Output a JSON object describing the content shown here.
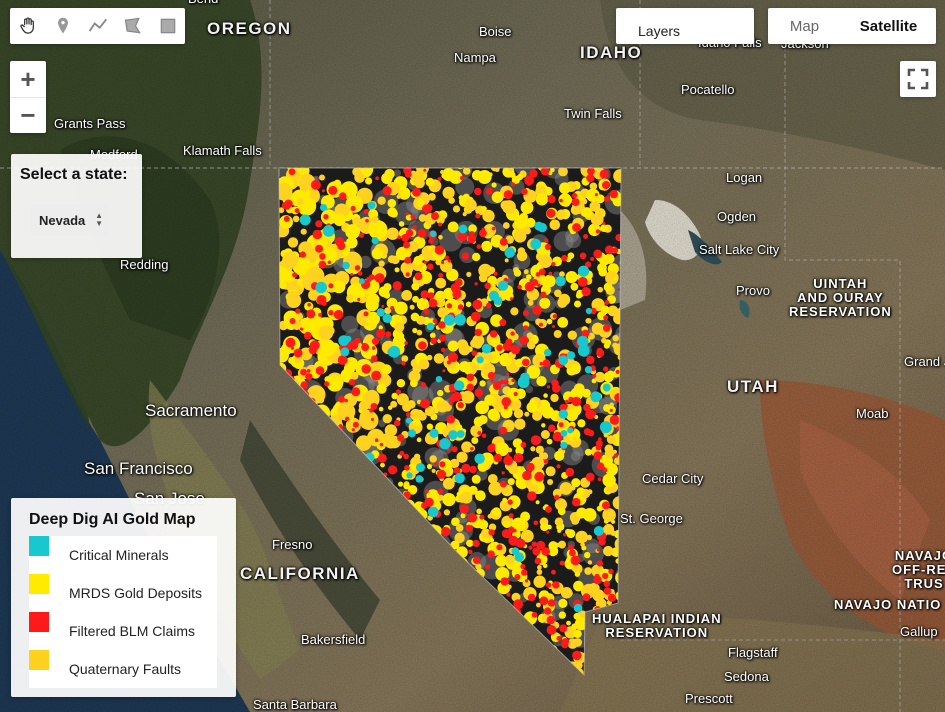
{
  "map": {
    "type": "satellite",
    "colors": {
      "critical": "#17c9cf",
      "mrds": "#ffea00",
      "blm": "#ff1a1a",
      "faults": "#ffd21f"
    },
    "places": [
      {
        "name": "OREGON",
        "kind": "state"
      },
      {
        "name": "IDAHO",
        "kind": "state"
      },
      {
        "name": "UTAH",
        "kind": "state"
      },
      {
        "name": "CALIFORNIA",
        "kind": "state"
      },
      {
        "name": "Bend",
        "kind": "city"
      },
      {
        "name": "Boise",
        "kind": "city"
      },
      {
        "name": "Nampa",
        "kind": "city"
      },
      {
        "name": "Idaho Falls",
        "kind": "city"
      },
      {
        "name": "Jackson",
        "kind": "city"
      },
      {
        "name": "Pocatello",
        "kind": "city"
      },
      {
        "name": "Twin Falls",
        "kind": "city"
      },
      {
        "name": "Grants Pass",
        "kind": "city"
      },
      {
        "name": "Medford",
        "kind": "city"
      },
      {
        "name": "Klamath Falls",
        "kind": "city"
      },
      {
        "name": "Logan",
        "kind": "city"
      },
      {
        "name": "Ogden",
        "kind": "city"
      },
      {
        "name": "Salt Lake City",
        "kind": "city"
      },
      {
        "name": "Provo",
        "kind": "city"
      },
      {
        "name": "UINTAH\nAND OURAY\nRESERVATION",
        "kind": "reserve"
      },
      {
        "name": "Redding",
        "kind": "city"
      },
      {
        "name": "Grand Junction",
        "kind": "city"
      },
      {
        "name": "Moab",
        "kind": "city"
      },
      {
        "name": "Sacramento",
        "kind": "city-big"
      },
      {
        "name": "San Francisco",
        "kind": "city-big"
      },
      {
        "name": "San Jose",
        "kind": "city-big"
      },
      {
        "name": "Cedar City",
        "kind": "city"
      },
      {
        "name": "St. George",
        "kind": "city"
      },
      {
        "name": "Fresno",
        "kind": "city"
      },
      {
        "name": "HUALAPAI INDIAN\nRESERVATION",
        "kind": "reserve"
      },
      {
        "name": "NAVAJO\nOFF-RES\nTRUS",
        "kind": "reserve"
      },
      {
        "name": "NAVAJO NATIO",
        "kind": "reserve"
      },
      {
        "name": "Gallup",
        "kind": "city"
      },
      {
        "name": "Bakersfield",
        "kind": "city"
      },
      {
        "name": "Flagstaff",
        "kind": "city"
      },
      {
        "name": "Sedona",
        "kind": "city"
      },
      {
        "name": "Prescott",
        "kind": "city"
      },
      {
        "name": "Santa Barbara",
        "kind": "city"
      }
    ]
  },
  "toolbar": {
    "tools": [
      {
        "name": "hand-icon"
      },
      {
        "name": "marker-icon"
      },
      {
        "name": "line-icon"
      },
      {
        "name": "polygon-icon"
      },
      {
        "name": "rectangle-icon"
      }
    ]
  },
  "zoom": {
    "in": "+",
    "out": "−"
  },
  "state_panel": {
    "label": "Select a state:",
    "selected": "Nevada"
  },
  "layers": {
    "label": "Layers"
  },
  "maptype": {
    "map": "Map",
    "satellite": "Satellite",
    "active": "Satellite"
  },
  "legend": {
    "title": "Deep Dig AI Gold Map",
    "items": [
      {
        "label": "Critical Minerals",
        "color": "#17c9cf"
      },
      {
        "label": "MRDS Gold Deposits",
        "color": "#ffea00"
      },
      {
        "label": "Filtered BLM Claims",
        "color": "#ff1a1a"
      },
      {
        "label": "Quaternary Faults",
        "color": "#ffd21f"
      }
    ]
  }
}
